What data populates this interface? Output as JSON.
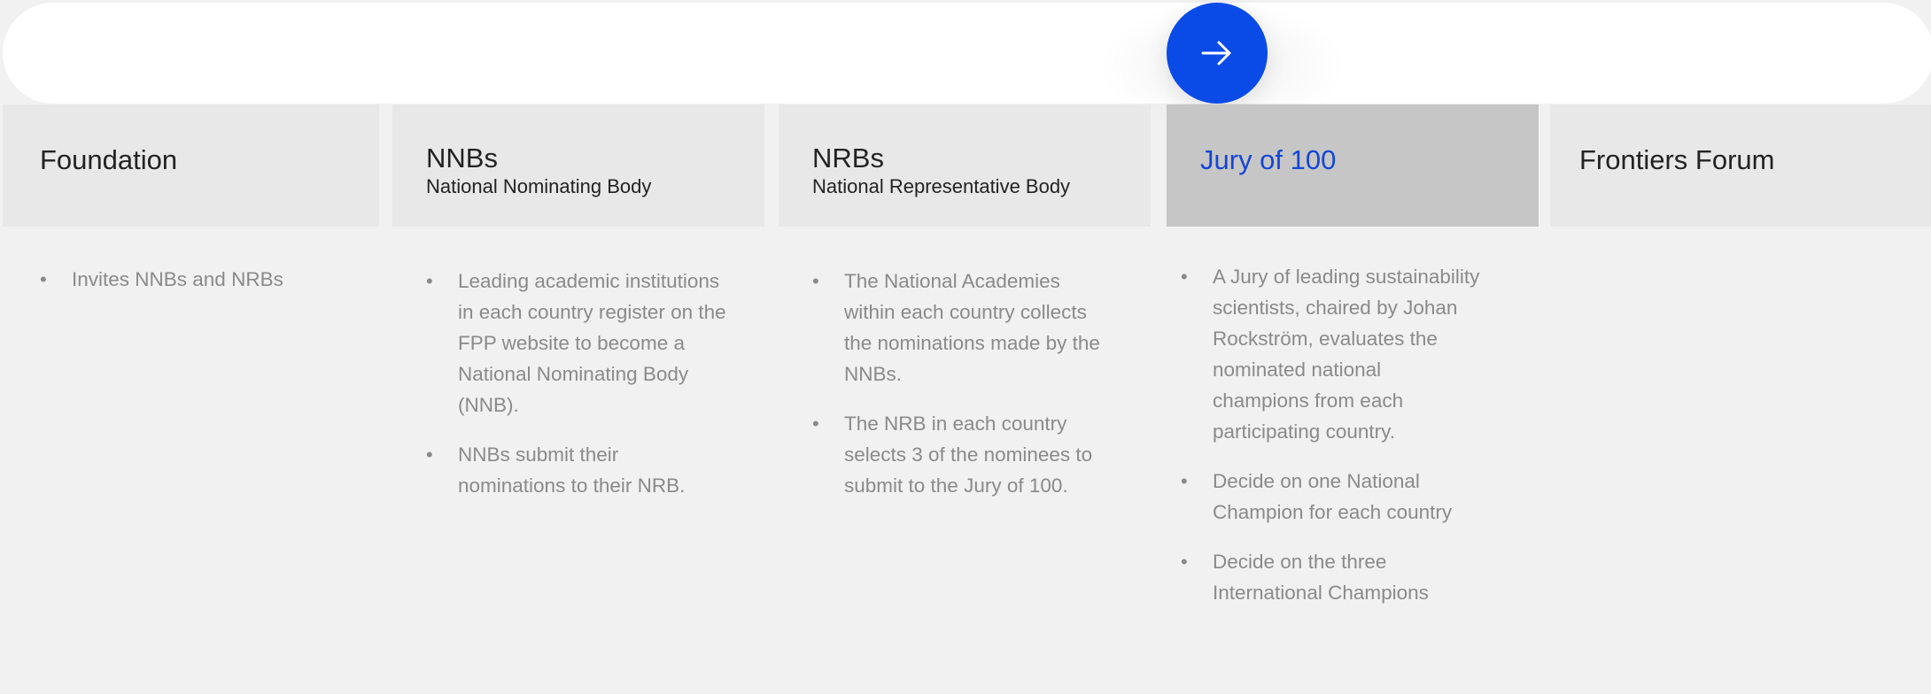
{
  "timeline": {
    "next_icon": "arrow-right-icon",
    "accent_color": "#0a4be8"
  },
  "columns": [
    {
      "title": "Foundation",
      "subtitle": "",
      "active": false,
      "bullets": [
        "Invites NNBs and NRBs"
      ]
    },
    {
      "title": "NNBs",
      "subtitle": "National Nominating Body",
      "active": false,
      "bullets": [
        "Leading academic institutions in each country register on the FPP website to become a National Nominating Body (NNB).",
        "NNBs submit their nominations to their NRB."
      ]
    },
    {
      "title": "NRBs",
      "subtitle": "National Representative Body",
      "active": false,
      "bullets": [
        "The National Academies within each country collects the nominations made by the NNBs.",
        "The NRB in each country selects 3 of the nominees to submit to the Jury of 100."
      ]
    },
    {
      "title": "Jury of 100",
      "subtitle": "",
      "active": true,
      "bullets": [
        "A Jury of leading sustainability scientists, chaired by Johan Rockström, evaluates the nominated national champions from each participating country.",
        "Decide on one National Champion for each country",
        "Decide on the three International Champions"
      ]
    },
    {
      "title": "Frontiers Forum",
      "subtitle": "",
      "active": false,
      "bullets": []
    }
  ]
}
